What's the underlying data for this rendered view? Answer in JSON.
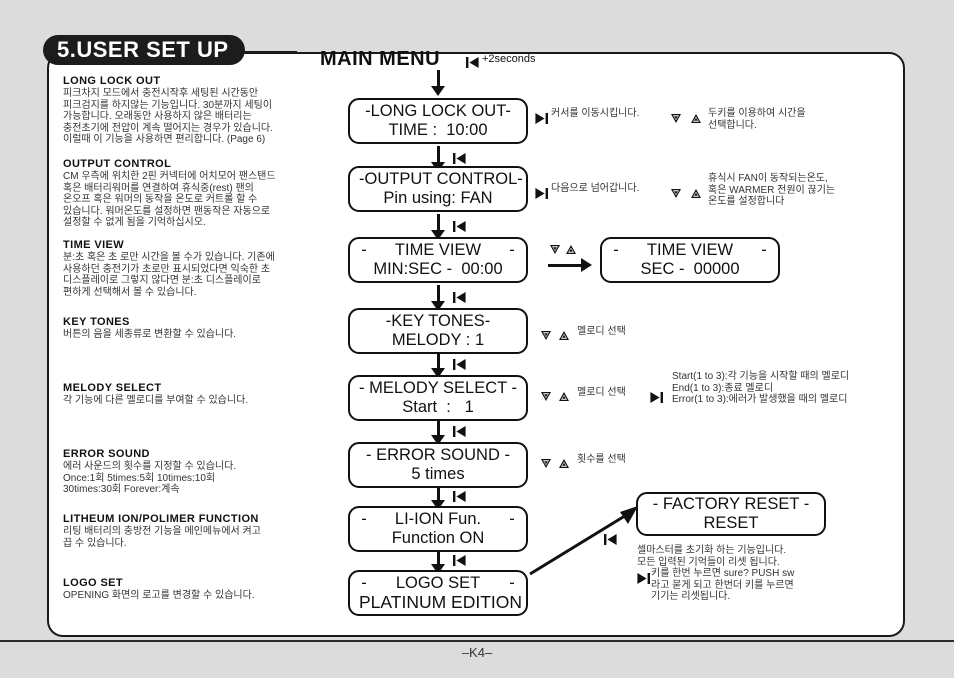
{
  "section": {
    "badge": "5.USER SET UP",
    "main_title": "MAIN MENU",
    "title_note": "+2seconds"
  },
  "footer": {
    "page": "–K4–"
  },
  "icons": {
    "skip_back": "skip-back-icon",
    "skip_forward": "skip-forward-icon",
    "triangle_down": "triangle-down-icon",
    "triangle_up": "triangle-up-icon"
  },
  "descriptions": [
    {
      "heading": "LONG LOCK OUT",
      "body": "피크차지 모드에서 충전시작후 세팅된 시간동안\n피크검지를 하지않는 기능입니다. 30분까지 세팅이\n가능합니다. 오래동안 사용하지 않은 배터리는\n충전초기에 전압이 계속 떨어지는 경우가 있습니다.\n이럴때 이 기능을 사용하면 편리합니다. (Page 6)"
    },
    {
      "heading": "OUTPUT CONTROL",
      "body": "CM 우측에 위치한 2핀 커넥터에 어치모어 팬스탠드\n혹은 배터리워머를 연결하여 휴식중(rest) 팬의\n온오프 혹은 워머의 동작을 온도로 커트롤 할 수\n있습니다. 워머온도를 설정하면 팬동작은 자동으로\n설정할 수 없게 됨을 기억하십시오."
    },
    {
      "heading": "TIME VIEW",
      "body": "분:초 혹은 초 로만 시간을 볼 수가 있습니다. 기존에\n사용하던 충전기가 초로만 표시되었다면 익숙한 초\n디스플레이로 그렇지 않다면 분:초 디스플레이로\n편하게 선택해서 볼 수 있습니다."
    },
    {
      "heading": "KEY TONES",
      "body": "버튼의 음을 세종류로 변환할 수 있습니다."
    },
    {
      "heading": "MELODY SELECT",
      "body": "각 기능에 다른 멜로디를 부여할 수 있습니다."
    },
    {
      "heading": "ERROR SOUND",
      "body": "에러 사운드의 횟수를 지정할 수 있습니다.\nOnce:1회 5times:5회 10times:10회\n30times:30회 Forever:계속"
    },
    {
      "heading": "LITHEUM ION/POLIMER FUNCTION",
      "body": "리팅 배터리의 충방전 기능을 메인메뉴에서 켜고\n끕 수 있습니다."
    },
    {
      "heading": "LOGO SET",
      "body": "OPENING 화면의 로고를 변경할 수 있습니다."
    }
  ],
  "menu_items": [
    {
      "line1": "-LONG LOCK OUT-",
      "line2": "TIME :  10:00",
      "split": false
    },
    {
      "line1": "-OUTPUT CONTROL-",
      "line2": "Pin using: FAN",
      "split": false
    },
    {
      "line1": "TIME VIEW",
      "line2": "MIN:SEC -  00:00",
      "split": true,
      "dash_left": "-",
      "dash_right": "-"
    },
    {
      "line1": "-KEY TONES-",
      "line2": "MELODY : 1",
      "split": false
    },
    {
      "line1": "- MELODY SELECT -",
      "line2": "Start  :   1",
      "split": false
    },
    {
      "line1": "- ERROR SOUND -",
      "line2": "5 times",
      "split": false
    },
    {
      "line1": "LI-ION Fun.",
      "line2": "Function ON",
      "split": true,
      "dash_left": "-",
      "dash_right": "-"
    },
    {
      "line1": "LOGO SET",
      "line2": "PLATINUM EDITION",
      "split": true,
      "dash_left": "-",
      "dash_right": "-"
    }
  ],
  "time_view_alt": {
    "line1": "TIME VIEW",
    "line2": "SEC -  00000",
    "dash_left": "-",
    "dash_right": "-"
  },
  "factory_reset": {
    "line1": "- FACTORY RESET -",
    "line2": "RESET",
    "note_a": "셀마스터를 초기화 하는 기능입니다.\n모든 입력된 기억들이 리셋 됩니다.",
    "note_b": "키를 한번 누르면 sure? PUSH sw\n라고 묻게 되고 한번더 키를 누르면\n기기는 리셋됩니다."
  },
  "annotations": {
    "long_lock_out_fwd": "커서를 이동시킵니다.",
    "long_lock_out_ud": "두키를 이용하여 시간을\n선택합니다.",
    "output_control_fwd": "다음으로 넘어갑니다.",
    "output_control_ud": "휴식시 FAN이 동작되는온도,\n혹은 WARMER 전원이 끊기는\n온도를 설정합니다",
    "key_tones_ud": "멜로디 선택",
    "melody_select_ud": "멜로디 선택",
    "melody_select_fwd": "Start(1 to 3):각 기능을 시작할 때의 멜로디\nEnd(1 to 3):종료 멜로디\nError(1 to 3):에러가 발생했을 때의 멜로디",
    "error_sound_ud": "횟수를 선택"
  },
  "colors": {
    "ink": "#111111",
    "paper": "#ffffff",
    "page_bg": "#dcdcdc",
    "badge_bg": "#1c1c1c"
  }
}
